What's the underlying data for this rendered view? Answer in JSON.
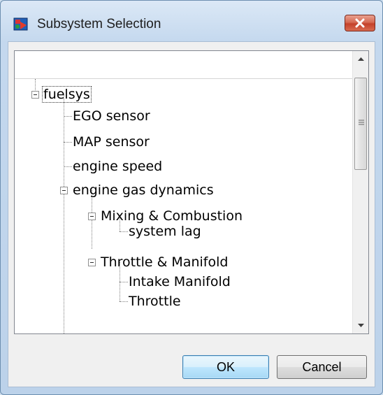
{
  "window": {
    "title": "Subsystem Selection"
  },
  "tree": {
    "header": "",
    "nodes": [
      {
        "label": "fuelsys",
        "level": 0,
        "expandable": true,
        "selected": true
      },
      {
        "label": "EGO sensor",
        "level": 1
      },
      {
        "label": "MAP sensor",
        "level": 1
      },
      {
        "label": "engine speed",
        "level": 1
      },
      {
        "label": "engine gas dynamics",
        "level": 1,
        "expandable": true
      },
      {
        "label": "Mixing & Combustion",
        "level": 2,
        "expandable": true
      },
      {
        "label": "system lag",
        "level": 3
      },
      {
        "label": "Throttle & Manifold",
        "level": 2,
        "expandable": true
      },
      {
        "label": "Intake Manifold",
        "level": 3
      },
      {
        "label": "Throttle",
        "level": 3
      }
    ]
  },
  "buttons": {
    "ok": "OK",
    "cancel": "Cancel"
  },
  "icons": {
    "app": "simulink-model-icon",
    "close": "close-icon"
  },
  "colors": {
    "close_button": "#c4412a",
    "selection_outline": "#333333",
    "ok_border": "#3c7fb1"
  }
}
